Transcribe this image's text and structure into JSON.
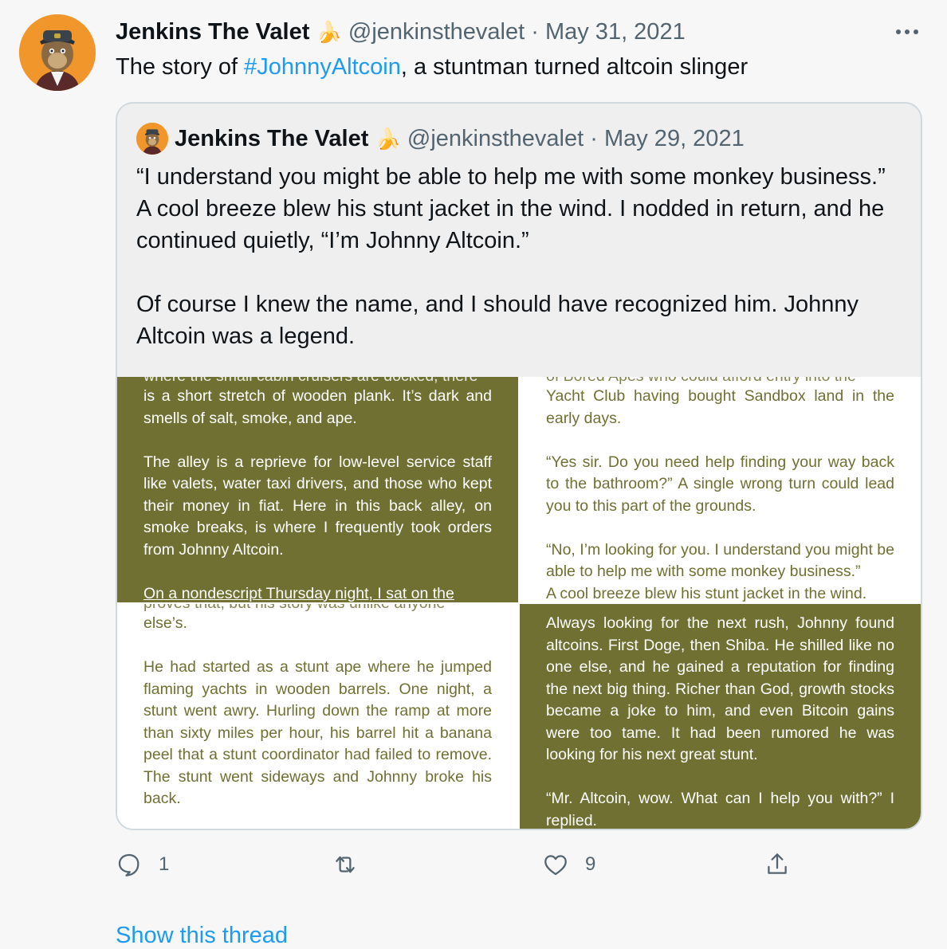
{
  "tweet": {
    "author_name": "Jenkins The Valet",
    "author_emoji": "🍌",
    "handle": "@jenkinsthevalet",
    "separator": "·",
    "date": "May 31, 2021",
    "text_before": "The story of ",
    "hashtag": "#JohnnyAltcoin",
    "text_after": ", a stuntman turned altcoin slinger"
  },
  "quoted": {
    "author_name": "Jenkins The Valet",
    "author_emoji": "🍌",
    "handle": "@jenkinsthevalet",
    "separator": "·",
    "date": "May 29, 2021",
    "paragraph1": "“I understand you might be able to help me with some monkey business.” A cool breeze blew his stunt jacket in the wind. I nodded in return, and he continued quietly, “I’m Johnny Altcoin.”",
    "paragraph2": "Of course I knew the name, and I should have recognized him. Johnny Altcoin was a legend."
  },
  "pages": {
    "p1": {
      "top_cut": "where the small cabin cruisers are docked, there",
      "lines_a": "is a short stretch of wooden plank. It’s dark and smells of salt, smoke, and ape.",
      "lines_b": "The alley is a reprieve for low-level service staff like valets, water taxi drivers, and those who kept their money in fiat. Here in this back alley, on smoke breaks, is where I frequently took orders from Johnny Altcoin.",
      "bottom_cut": "On a nondescript Thursday night, I sat on the"
    },
    "p2": {
      "top_cut": "of Bored Apes who could afford entry into the",
      "lines_a": "Yacht Club having bought Sandbox land in the early days.",
      "lines_b": "“Yes sir. Do you need help finding your way back to the bathroom?” A single wrong turn could lead you to this part of the grounds.",
      "lines_c": "“No, I’m looking for you. I understand you might be able to help me with some monkey business.”",
      "bottom_cut": "A cool breeze blew his stunt jacket in the wind."
    },
    "p3": {
      "top_cut": "proves that, but his story was unlike anyone",
      "lines_a": "else’s.",
      "lines_b": "He had started as a stunt ape where he jumped flaming yachts in wooden barrels. One night, a stunt went awry. Hurling down the ramp at more than sixty miles per hour, his barrel hit a banana peel that a stunt coordinator had failed to remove. The stunt went sideways and Johnny broke his back."
    },
    "p4": {
      "lines_a": "Always looking for the next rush, Johnny found altcoins. First Doge, then Shiba. He shilled like no one else, and he gained a reputation for finding the next big thing. Richer than God, growth stocks became a joke to him, and even Bitcoin gains were too tame. It had been rumored he was looking for his next great stunt.",
      "lines_b": "“Mr. Altcoin, wow. What can I help you with?” I replied."
    }
  },
  "actions": {
    "reply_count": "1",
    "retweet_count": "",
    "like_count": "9"
  },
  "footer": {
    "show_thread": "Show this thread"
  },
  "colors": {
    "olive": "#6f7032",
    "link": "#1d9bf0",
    "muted": "#536471"
  }
}
